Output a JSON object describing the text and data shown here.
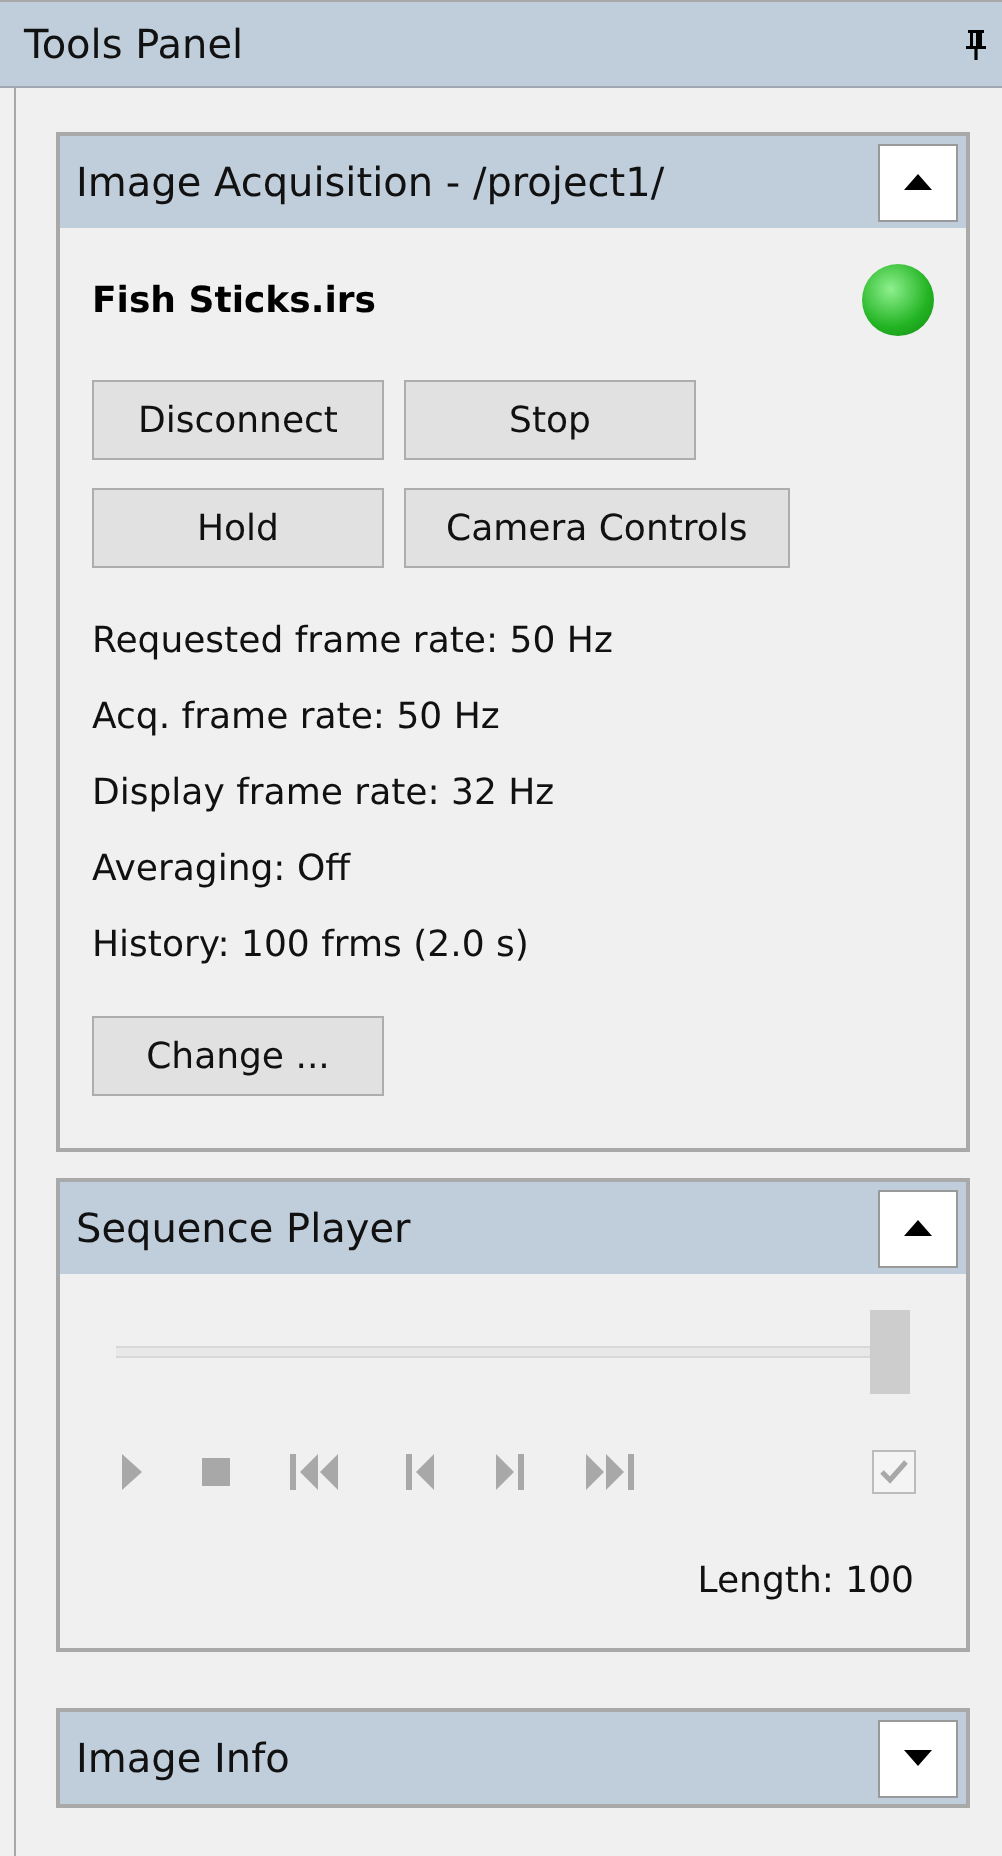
{
  "panel": {
    "title": "Tools Panel"
  },
  "acquisition": {
    "title": "Image Acquisition - /project1/",
    "expanded": true,
    "file": "Fish Sticks.irs",
    "connected": true,
    "buttons": [
      [
        "Disconnect",
        "Stop"
      ],
      [
        "Hold",
        "Camera Controls"
      ]
    ],
    "info": [
      "Requested frame rate: 50 Hz",
      "Acq. frame rate: 50 Hz",
      "Display frame rate: 32 Hz",
      "Averaging: Off",
      "History: 100 frms (2.0 s)"
    ],
    "change_button": "Change ..."
  },
  "player": {
    "title": "Sequence Player",
    "expanded": true,
    "level": 1,
    "disabled": true,
    "loop_checked": true,
    "length": "Length: 100",
    "controls": [
      {
        "kind": "play"
      },
      {
        "kind": "stop"
      },
      {
        "kind": "first"
      },
      {
        "kind": "prev"
      },
      {
        "kind": "next"
      },
      {
        "kind": "last"
      }
    ]
  },
  "image_info": {
    "title": "Image Info",
    "expanded": false
  }
}
